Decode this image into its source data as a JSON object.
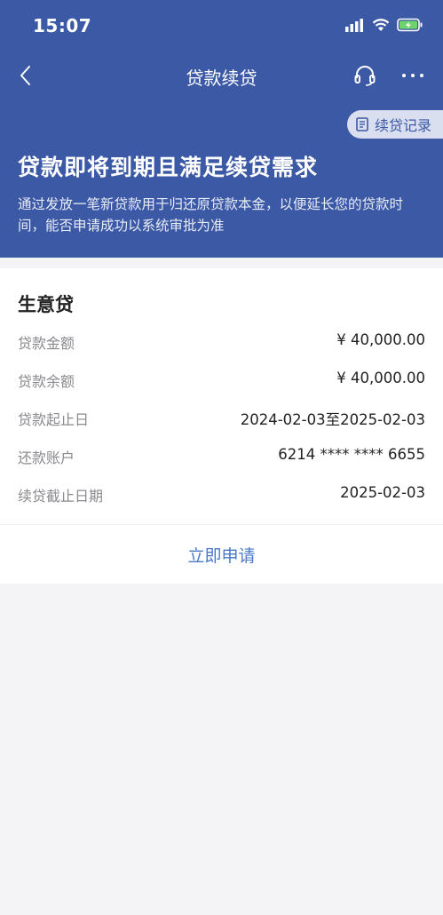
{
  "status_bar": {
    "time": "15:07"
  },
  "nav": {
    "title": "贷款续贷"
  },
  "record_button": {
    "label": "续贷记录"
  },
  "banner": {
    "headline": "贷款即将到期且满足续贷需求",
    "description": "通过发放一笔新贷款用于归还原贷款本金，以便延长您的贷款时间，能否申请成功以系统审批为准"
  },
  "loan_card": {
    "title": "生意贷",
    "rows": [
      {
        "label": "贷款金额",
        "value": "¥ 40,000.00"
      },
      {
        "label": "贷款余额",
        "value": "¥ 40,000.00"
      },
      {
        "label": "贷款起止日",
        "value": "2024-02-03至2025-02-03"
      },
      {
        "label": "还款账户",
        "value": "6214 **** **** 6655"
      },
      {
        "label": "续贷截止日期",
        "value": "2025-02-03"
      }
    ],
    "apply_label": "立即申请"
  },
  "colors": {
    "header_bg": "#3c59a6",
    "accent": "#4a78c8",
    "page_bg": "#f4f4f6",
    "battery": "#6ed36a"
  },
  "icons": [
    "back-icon",
    "headset-icon",
    "more-icon",
    "record-icon",
    "signal-icon",
    "wifi-icon",
    "battery-icon"
  ]
}
